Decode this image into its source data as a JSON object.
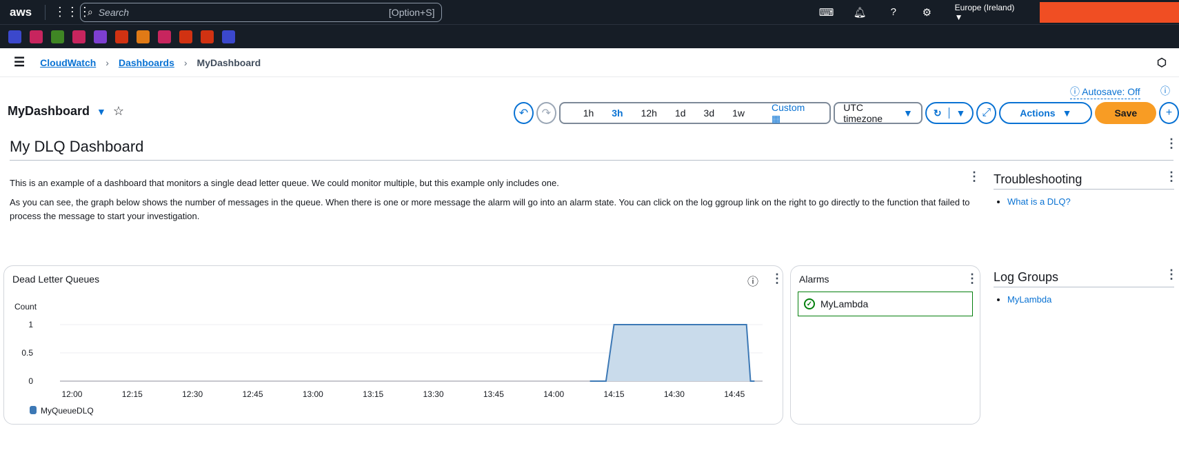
{
  "topbar": {
    "logo": "aws",
    "search_placeholder": "Search",
    "shortcut": "[Option+S]",
    "region": "Europe (Ireland)"
  },
  "favorites": [
    {
      "icon": "service-icon",
      "color": "#3b48cc"
    },
    {
      "icon": "service-icon",
      "color": "#c7255e"
    },
    {
      "icon": "s3-icon",
      "color": "#3f8624"
    },
    {
      "icon": "service-icon",
      "color": "#c7255e"
    },
    {
      "icon": "service-icon",
      "color": "#7d3fd1"
    },
    {
      "icon": "service-icon",
      "color": "#d13212"
    },
    {
      "icon": "lambda-icon",
      "color": "#e07a16"
    },
    {
      "icon": "service-icon",
      "color": "#c7255e"
    },
    {
      "icon": "service-icon",
      "color": "#d13212"
    },
    {
      "icon": "service-icon",
      "color": "#d13212"
    },
    {
      "icon": "service-icon",
      "color": "#3b48cc"
    }
  ],
  "breadcrumb": [
    "CloudWatch",
    "Dashboards",
    "MyDashboard"
  ],
  "header": {
    "title": "MyDashboard",
    "autosave": "Autosave: Off"
  },
  "toolbar": {
    "ranges": [
      "1h",
      "3h",
      "12h",
      "1d",
      "3d",
      "1w"
    ],
    "selected": "3h",
    "custom": "Custom",
    "timezone": "UTC timezone",
    "actions": "Actions",
    "save": "Save"
  },
  "dashboard": {
    "heading": "My DLQ Dashboard",
    "paragraphs": [
      "This is an example of a dashboard that monitors a single dead letter queue. We could monitor multiple, but this example only includes one.",
      "As you can see, the graph below shows the number of messages in the queue. When there is one or more message the alarm will go into an alarm state. You can click on the log ggroup link on the right to go directly to the function that failed to process the message to start your investigation."
    ],
    "troubleshooting": {
      "title": "Troubleshooting",
      "links": [
        "What is a DLQ?"
      ]
    },
    "alarms": {
      "title": "Alarms",
      "items": [
        {
          "name": "MyLambda",
          "state": "OK"
        }
      ]
    },
    "log_groups": {
      "title": "Log Groups",
      "links": [
        "MyLambda"
      ]
    },
    "graph_title": "Dead Letter Queues"
  },
  "chart_data": {
    "type": "area",
    "ylabel": "Count",
    "ylim": [
      0,
      1
    ],
    "yticks": [
      "0",
      "0.5",
      "1"
    ],
    "xlim": [
      "11:57",
      "14:52"
    ],
    "xticks": [
      "12:00",
      "12:15",
      "12:30",
      "12:45",
      "13:00",
      "13:15",
      "13:30",
      "13:45",
      "14:00",
      "14:15",
      "14:30",
      "14:45"
    ],
    "legend_position": "bottom-left",
    "grid": true,
    "series": [
      {
        "name": "MyQueueDLQ",
        "color": "#3c78b5",
        "x": [
          "14:09",
          "14:13",
          "14:15",
          "14:48",
          "14:49",
          "14:50"
        ],
        "y": [
          0,
          0,
          1,
          1,
          0,
          0
        ]
      }
    ]
  }
}
